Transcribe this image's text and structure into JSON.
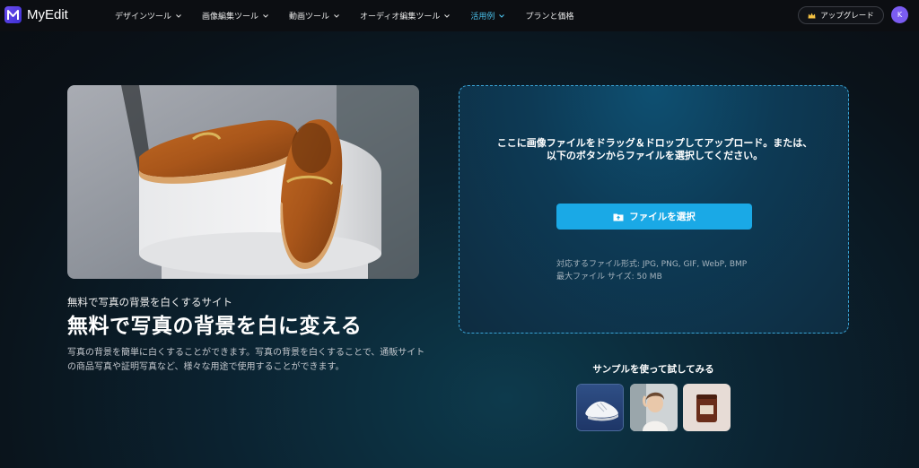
{
  "app": {
    "name": "MyEdit"
  },
  "nav": {
    "items": [
      {
        "label": "デザインツール"
      },
      {
        "label": "画像編集ツール"
      },
      {
        "label": "動画ツール"
      },
      {
        "label": "オーディオ編集ツール"
      },
      {
        "label": "活用例"
      },
      {
        "label": "プランと価格"
      }
    ],
    "active_index": 4,
    "upgrade_label": "アップグレード",
    "avatar_initial": "K"
  },
  "hero": {
    "eyebrow": "無料で写真の背景を白くするサイト",
    "headline": "無料で写真の背景を白に変える",
    "description": "写真の背景を簡単に白くすることができます。写真の背景を白くすることで、通販サイトの商品写真や証明写真など、様々な用途で使用することができます。"
  },
  "upload": {
    "instruction": "ここに画像ファイルをドラッグ＆ドロップしてアップロード。または、以下のボタンからファイルを選択してください。",
    "button_label": "ファイルを選択",
    "formats": "対応するファイル形式: JPG, PNG, GIF, WebP, BMP",
    "max_size": "最大ファイル サイズ: 50 MB"
  },
  "samples": {
    "title": "サンプルを使って試してみる"
  },
  "colors": {
    "accent": "#1aa9e6",
    "active_nav": "#4cc3ee",
    "brand": "#6b4cf0"
  }
}
